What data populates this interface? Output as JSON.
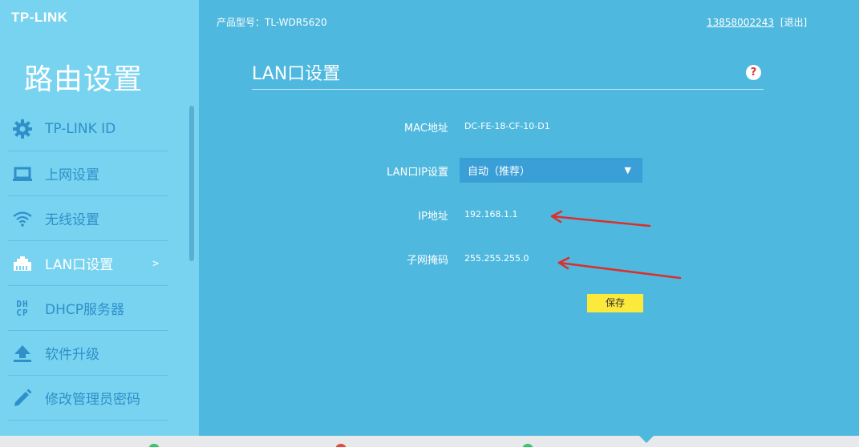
{
  "brand": {
    "logo_text": "TP-LINK"
  },
  "sidebar": {
    "title": "路由设置",
    "items": [
      {
        "label": "TP-LINK ID",
        "icon": "gear-icon",
        "active": false
      },
      {
        "label": "上网设置",
        "icon": "laptop-icon",
        "active": false
      },
      {
        "label": "无线设置",
        "icon": "wifi-icon",
        "active": false
      },
      {
        "label": "LAN口设置",
        "icon": "lan-port-icon",
        "active": true,
        "arrow": ">"
      },
      {
        "label": "DHCP服务器",
        "icon": "dhcp-icon",
        "icon_text_top": "DH",
        "icon_text_bottom": "CP",
        "active": false
      },
      {
        "label": "软件升级",
        "icon": "upload-icon",
        "active": false
      },
      {
        "label": "修改管理员密码",
        "icon": "pencil-icon",
        "active": false
      }
    ]
  },
  "header": {
    "model": "产品型号：TL-WDR5620",
    "user": "13858002243",
    "logout": "[退出]"
  },
  "main": {
    "title": "LAN口设置",
    "help": "?",
    "fields": {
      "mac": {
        "label": "MAC地址",
        "value": "DC-FE-18-CF-10-D1"
      },
      "lan_ip_setting": {
        "label": "LAN口IP设置",
        "selected": "自动（推荐）"
      },
      "ip": {
        "label": "IP地址",
        "value": "192.168.1.1"
      },
      "subnet": {
        "label": "子网掩码",
        "value": "255.255.255.0"
      }
    },
    "save_label": "保存"
  },
  "colors": {
    "background": "#4fb8de",
    "sidebar": "#78d3f0",
    "nav_text": "#2f8fc9",
    "select_bg": "#3a9fd6",
    "save_button": "#fbe93b",
    "annotation_arrow": "#d9302c"
  }
}
